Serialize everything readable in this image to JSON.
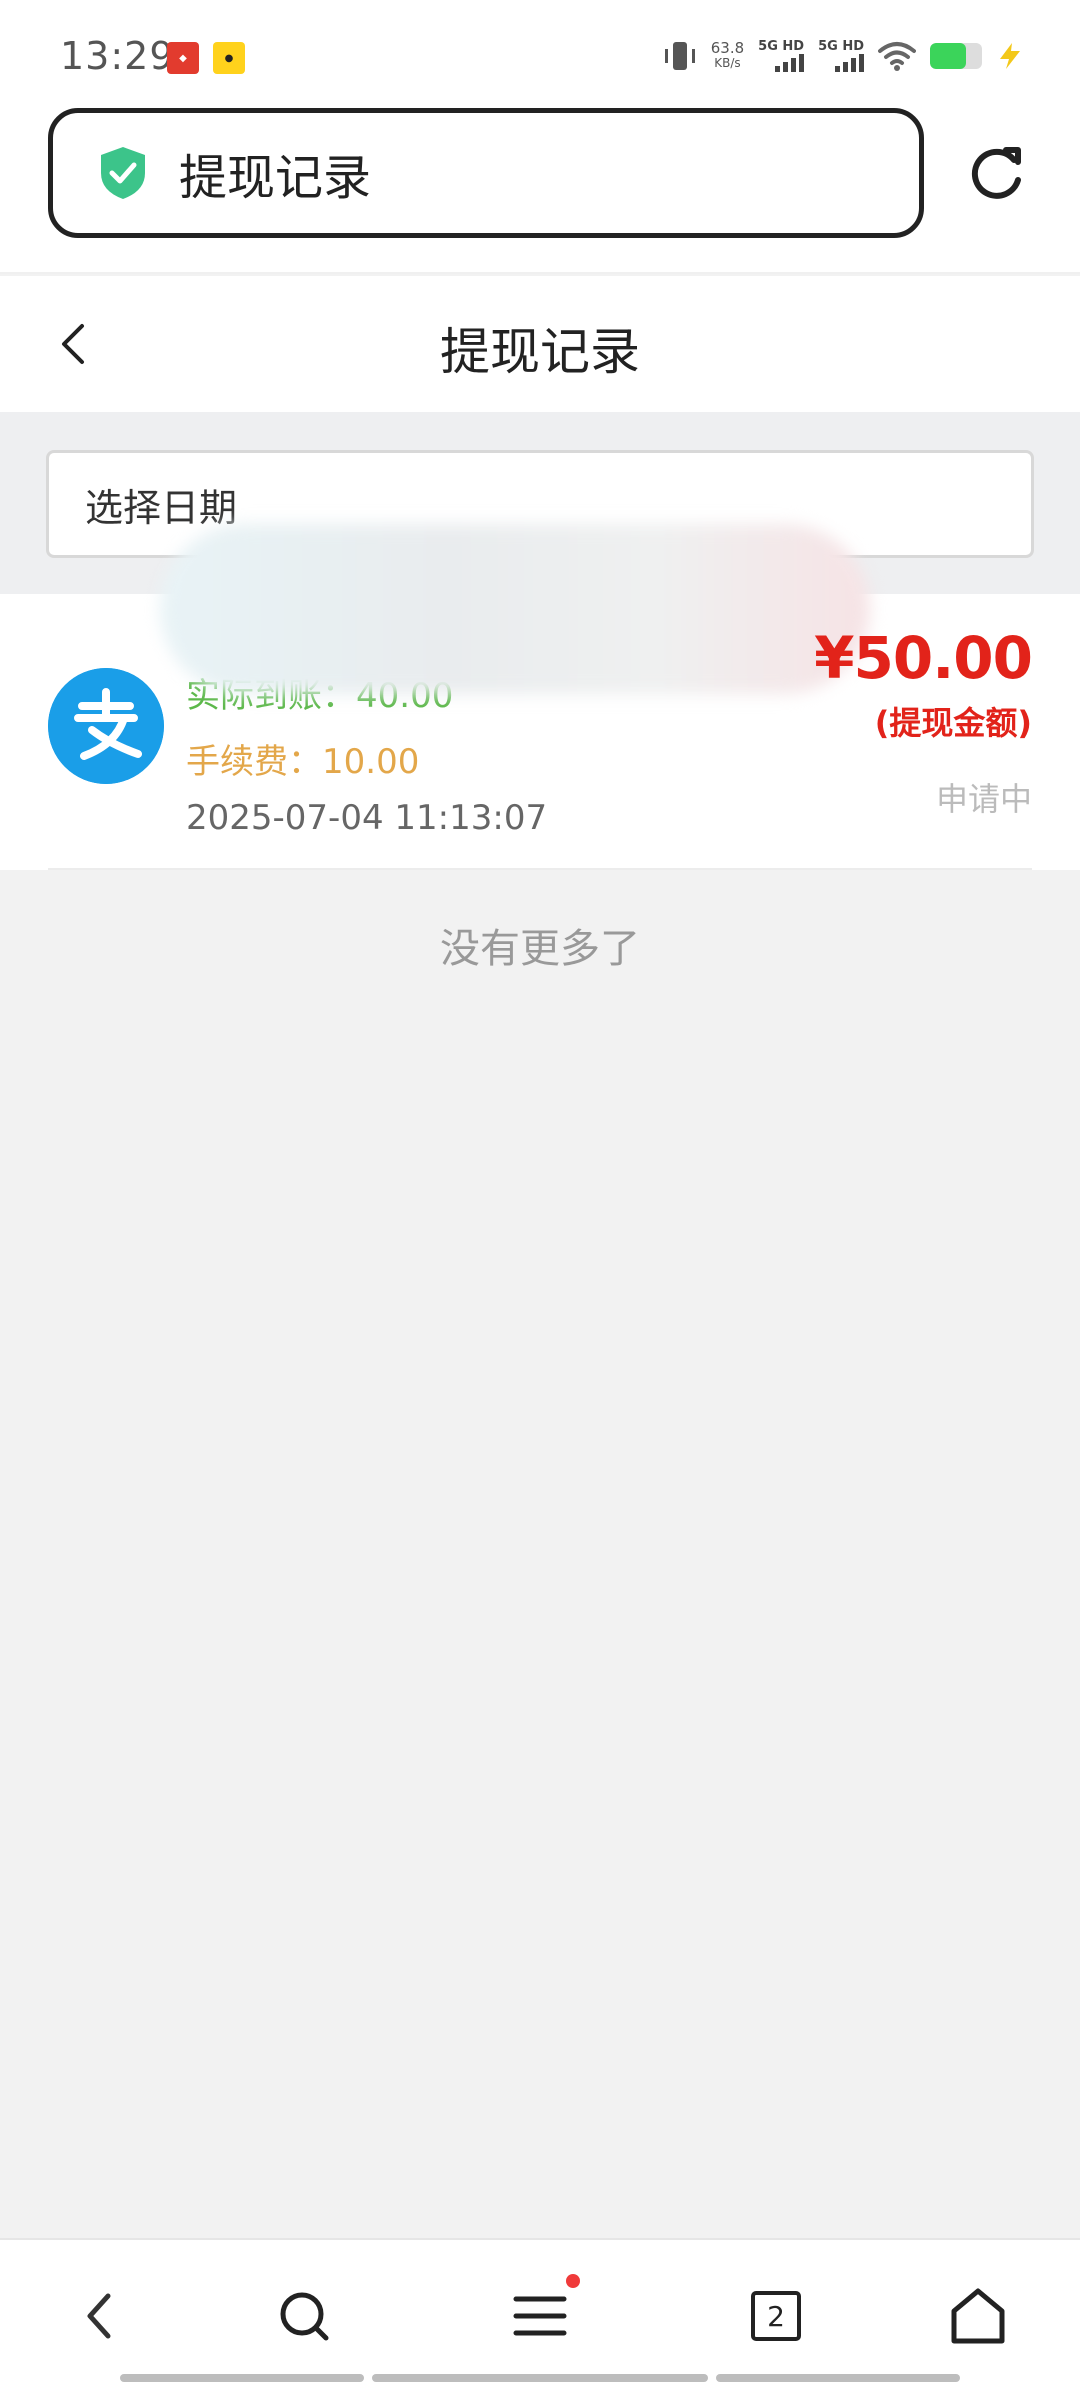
{
  "status_bar": {
    "time": "13:29",
    "net_speed_value": "63.8",
    "net_speed_unit": "KB/s",
    "sim1_label": "5G HD",
    "sim2_label": "5G HD",
    "icons": [
      "vibrate-icon",
      "wifi-icon",
      "battery-icon",
      "charging-icon"
    ]
  },
  "browser": {
    "url_title": "提现记录",
    "tab_count": "2"
  },
  "header": {
    "title": "提现记录"
  },
  "filter": {
    "date_placeholder": "选择日期"
  },
  "record": {
    "actual_label": "实际到账：",
    "actual_value": "40.00",
    "fee_label": "手续费：",
    "fee_value": "10.00",
    "time": "2025-07-04 11:13:07",
    "amount": "¥50.00",
    "amount_label": "(提现金额)",
    "status": "申请中",
    "method_icon": "alipay-icon"
  },
  "list": {
    "end_text": "没有更多了"
  },
  "colors": {
    "accent_red": "#e2231a",
    "fee_orange": "#e3a74a",
    "actual_green": "#5cb84a",
    "alipay_blue": "#1a9ee8",
    "shield_green": "#3cc48a"
  }
}
